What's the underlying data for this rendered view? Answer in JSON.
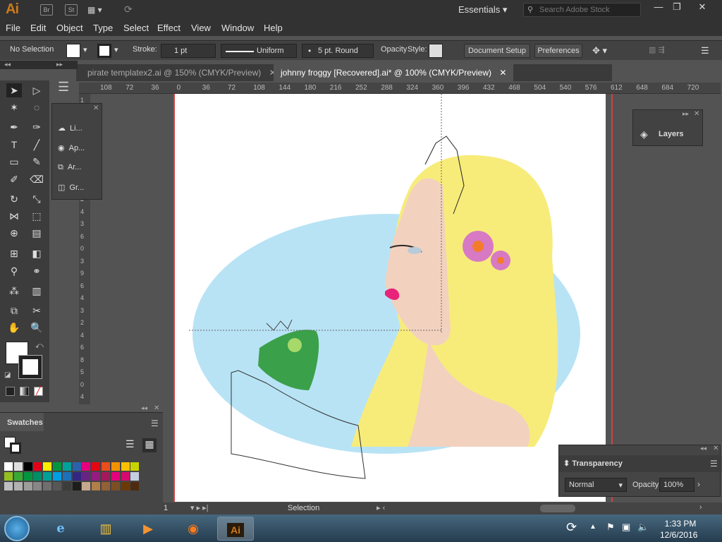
{
  "app": {
    "logo": "Ai",
    "bridge": "Br",
    "stock": "St",
    "workspace": "Essentials",
    "search_placeholder": "Search Adobe Stock"
  },
  "menu": [
    "File",
    "Edit",
    "Object",
    "Type",
    "Select",
    "Effect",
    "View",
    "Window",
    "Help"
  ],
  "control": {
    "selection": "No Selection",
    "stroke_label": "Stroke:",
    "stroke_value": "1 pt",
    "stroke_style": "Uniform",
    "brush": "5 pt. Round",
    "opacity_label": "Opacity",
    "style_label": "Style:",
    "doc_setup": "Document Setup",
    "preferences": "Preferences"
  },
  "tabs": [
    {
      "label": "pirate templatex2.ai @ 150% (CMYK/Preview)"
    },
    {
      "label": "johnny froggy [Recovered].ai* @ 100% (CMYK/Preview)"
    }
  ],
  "ruler_h": [
    "108",
    "72",
    "36",
    "0",
    "36",
    "72",
    "108",
    "144",
    "180",
    "216",
    "252",
    "288",
    "324",
    "360",
    "396",
    "432",
    "468",
    "504",
    "540",
    "576",
    "612",
    "648",
    "684",
    "720"
  ],
  "ruler_v": [
    "1",
    "2",
    "5",
    "2",
    "2",
    "8",
    "8",
    "3",
    "2",
    "4",
    "3",
    "6",
    "0",
    "3",
    "9",
    "6",
    "4",
    "3",
    "2",
    "4",
    "6",
    "8",
    "5",
    "0",
    "4"
  ],
  "mini_panel": [
    "Li...",
    "Ap...",
    "Ar...",
    "Gr..."
  ],
  "swatches": {
    "title": "Swatches"
  },
  "layers": {
    "title": "Layers"
  },
  "transparency": {
    "title": "Transparency",
    "mode": "Normal",
    "opacity_label": "Opacity:",
    "opacity": "100%"
  },
  "status": {
    "page": "1",
    "tool": "Selection"
  },
  "clock": {
    "time": "1:33 PM",
    "date": "12/6/2016"
  },
  "colors": {
    "accent": "#cc7a1a",
    "hair": "#f7ec7a",
    "bg_blue": "#b8e3f5",
    "skin": "#f2d2be",
    "frog": "#3aa04a"
  }
}
